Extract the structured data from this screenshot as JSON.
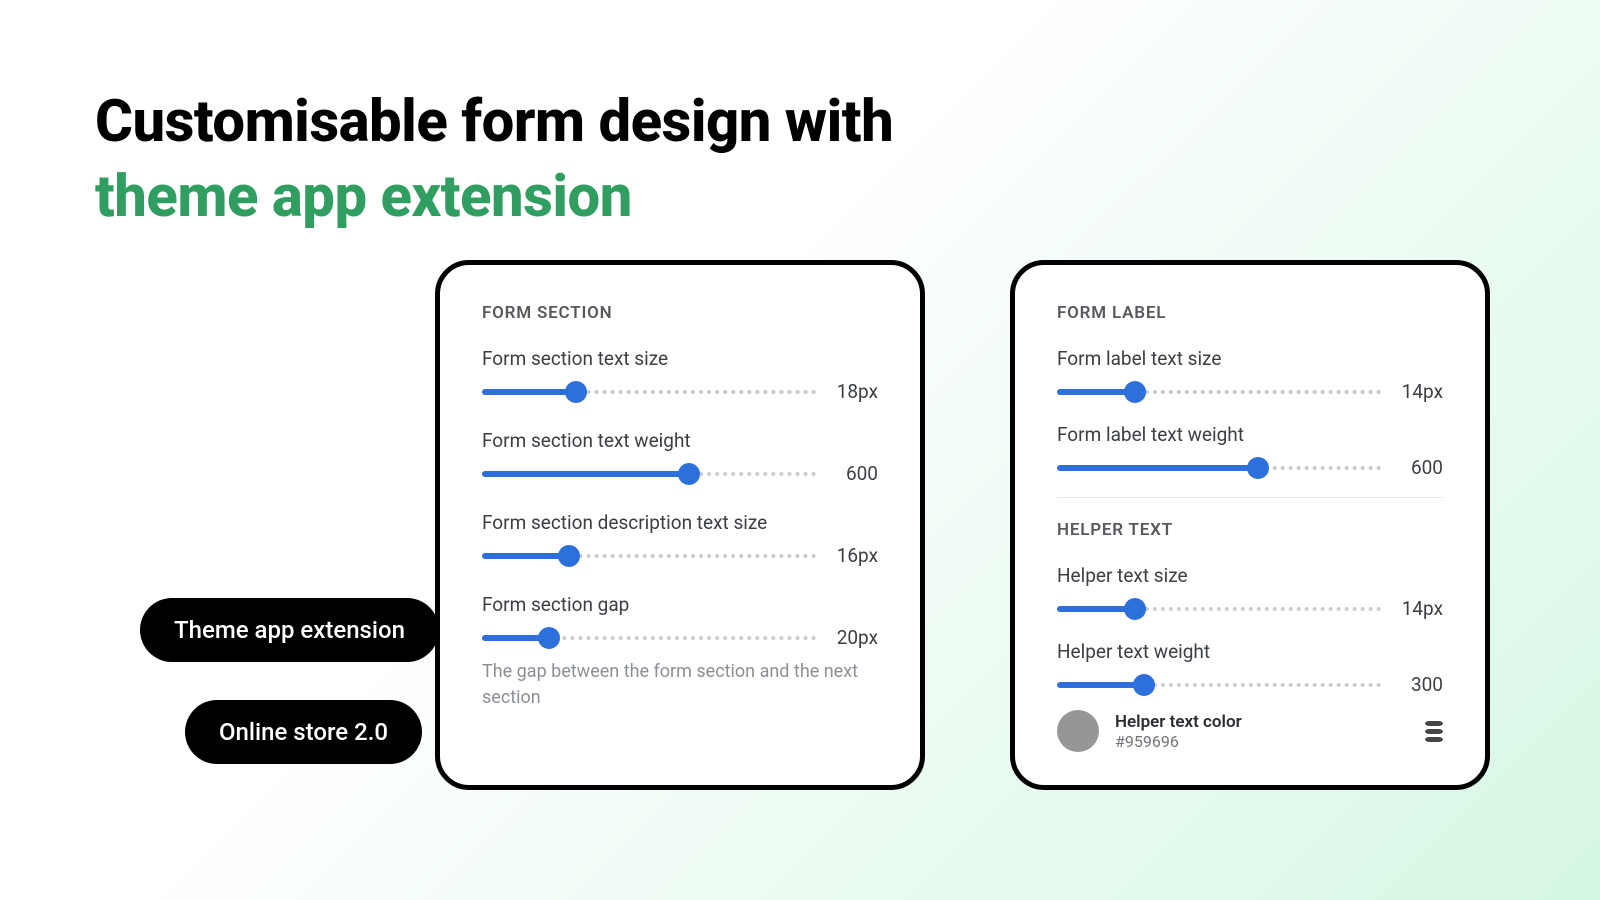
{
  "headline": {
    "line1": "Customisable form design with",
    "line2": "theme app extension"
  },
  "pills": {
    "theme_ext": "Theme app extension",
    "online_store": "Online store 2.0"
  },
  "left": {
    "title": "FORM SECTION",
    "controls": [
      {
        "label": "Form section text size",
        "value": "18px",
        "fill": 28
      },
      {
        "label": "Form section text weight",
        "value": "600",
        "fill": 62
      },
      {
        "label": "Form section description text size",
        "value": "16px",
        "fill": 26
      },
      {
        "label": "Form section gap",
        "value": "20px",
        "fill": 20
      }
    ],
    "help": "The gap between the form section and the next section"
  },
  "right": {
    "label_title": "FORM LABEL",
    "label_controls": [
      {
        "label": "Form label text size",
        "value": "14px",
        "fill": 24
      },
      {
        "label": "Form label text weight",
        "value": "600",
        "fill": 62
      }
    ],
    "helper_title": "HELPER TEXT",
    "helper_controls": [
      {
        "label": "Helper text size",
        "value": "14px",
        "fill": 24
      },
      {
        "label": "Helper text weight",
        "value": "300",
        "fill": 27
      }
    ],
    "color": {
      "label": "Helper text color",
      "hex": "#959696"
    }
  },
  "colors": {
    "accent": "#2f9e60",
    "slider": "#2d6fdb"
  }
}
